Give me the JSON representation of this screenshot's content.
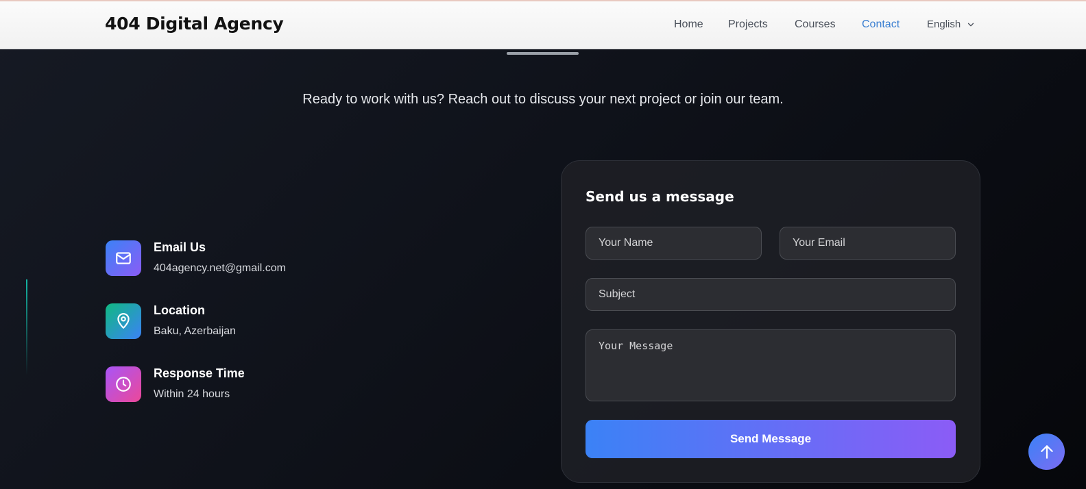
{
  "navbar": {
    "brand": "404 Digital Agency",
    "items": [
      {
        "label": "Home"
      },
      {
        "label": "Projects"
      },
      {
        "label": "Courses"
      },
      {
        "label": "Contact"
      }
    ],
    "language": {
      "label": "English",
      "icon": "chevron-down-icon"
    }
  },
  "hero": {
    "tagline": "Ready to work with us? Reach out to discuss your next project or join our team."
  },
  "contact_info": [
    {
      "title": "Email Us",
      "value": "404agency.net@gmail.com",
      "icon": "mail-icon"
    },
    {
      "title": "Location",
      "value": "Baku, Azerbaijan",
      "icon": "map-pin-icon"
    },
    {
      "title": "Response Time",
      "value": "Within 24 hours",
      "icon": "clock-icon"
    }
  ],
  "form": {
    "title": "Send us a message",
    "name_placeholder": "Your Name",
    "email_placeholder": "Your Email",
    "subject_placeholder": "Subject",
    "message_placeholder": "Your Message",
    "submit_label": "Send Message"
  },
  "colors": {
    "accent_active": "#3b7fd1",
    "gradient_blue": "#3b82f6",
    "gradient_purple": "#8b5cf6"
  }
}
